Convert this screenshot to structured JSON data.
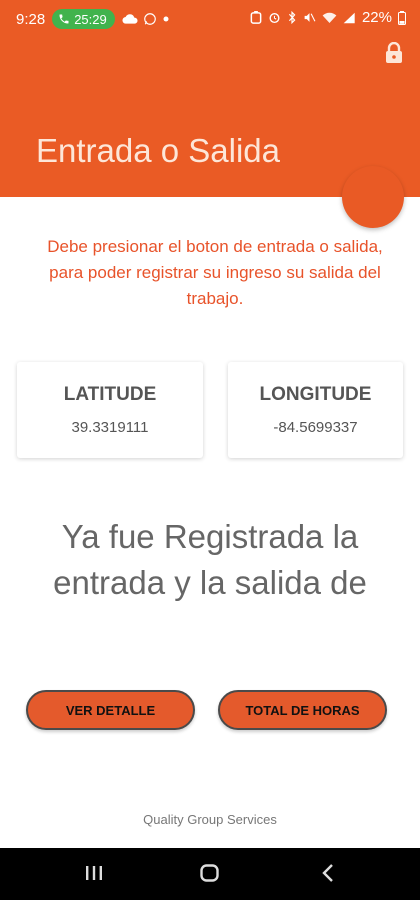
{
  "status_bar": {
    "time": "9:28",
    "call_duration": "25:29",
    "battery": "22%",
    "icons": [
      "phone-icon",
      "cloud-icon",
      "whatsapp-icon",
      "dot-icon",
      "battery-saver-icon",
      "alarm-icon",
      "bluetooth-icon",
      "mute-icon",
      "wifi-icon",
      "signal-icon",
      "battery-icon"
    ]
  },
  "app_bar": {
    "title": "Entrada o Salida",
    "lock_icon": "lock-icon"
  },
  "notice": "Debe presionar el boton de entrada o salida, para poder registrar su ingreso su salida del trabajo.",
  "coordinates": {
    "latitude_label": "LATITUDE",
    "latitude_value": "39.3319111",
    "longitude_label": "LONGITUDE",
    "longitude_value": "-84.5699337"
  },
  "message": "Ya fue Registrada la entrada y la salida de",
  "buttons": {
    "detail": "VER DETALLE",
    "hours": "TOTAL DE HORAS"
  },
  "footer": "Quality Group Services",
  "colors": {
    "brand": "#ea5b25",
    "notice_text": "#e8532a",
    "call_pill": "#41b34d"
  }
}
